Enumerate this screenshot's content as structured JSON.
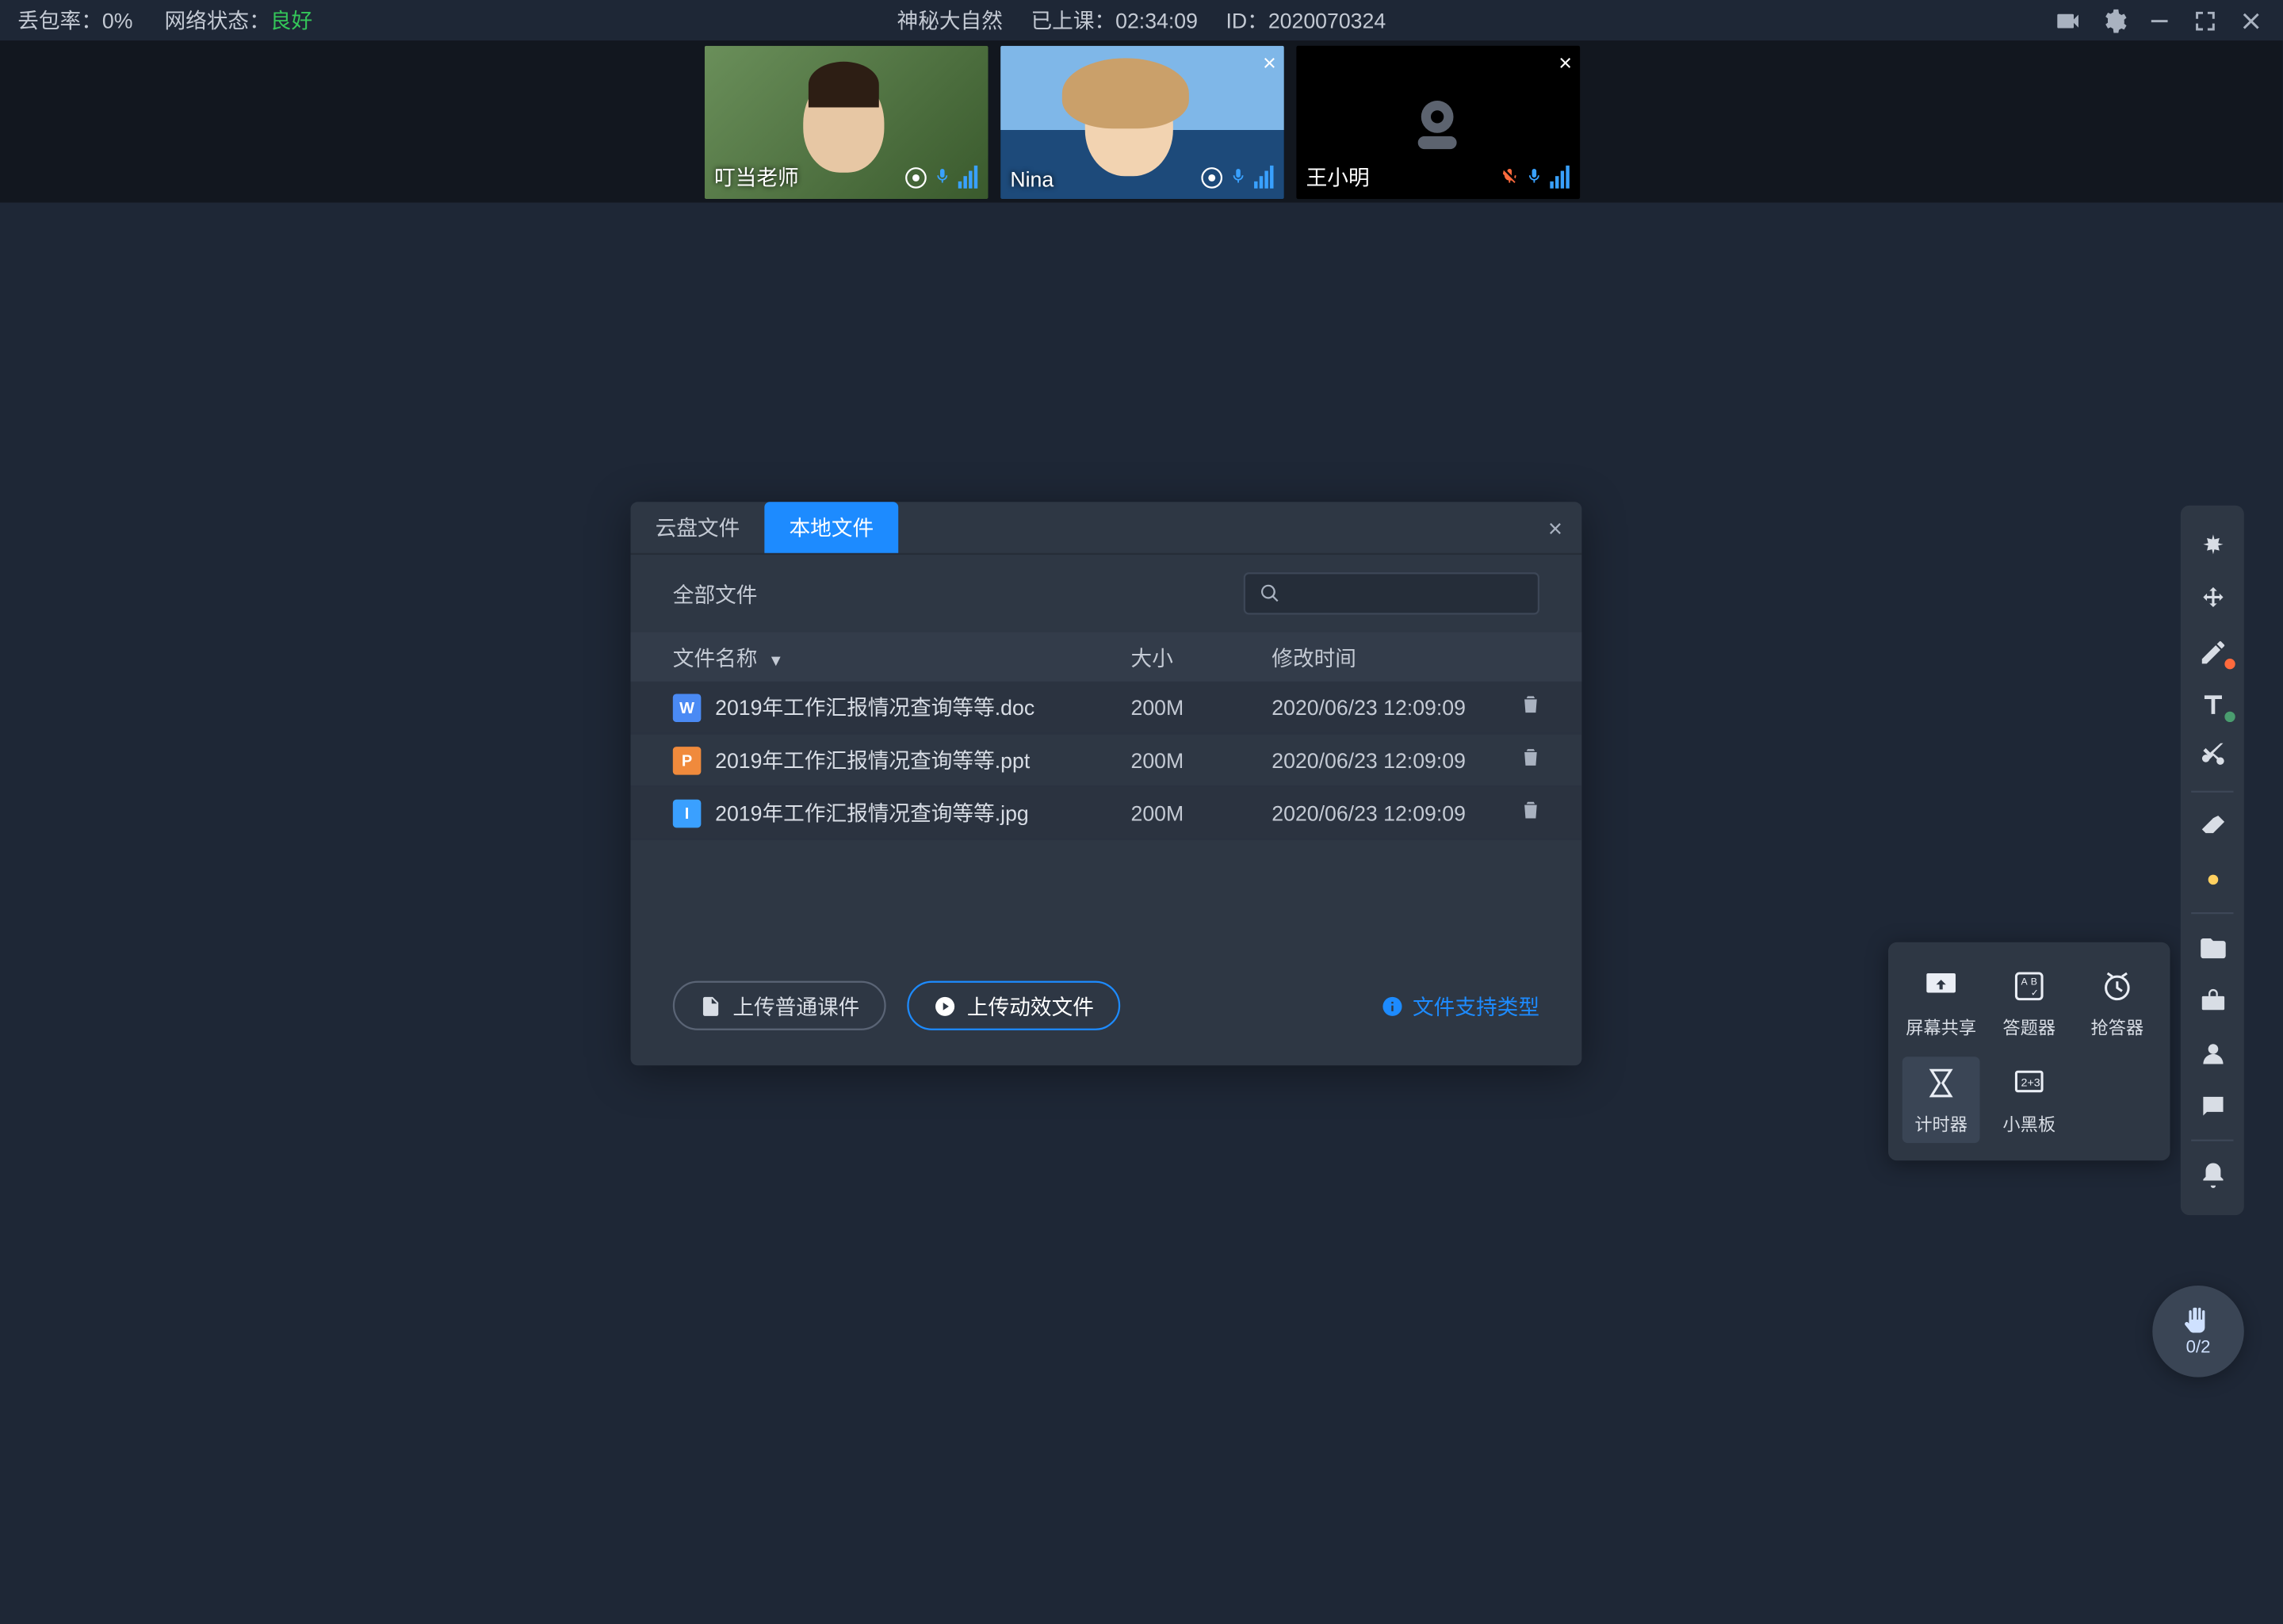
{
  "topbar": {
    "packet_loss_label": "丢包率：",
    "packet_loss_value": "0%",
    "net_label": "网络状态：",
    "net_value": "良好",
    "title": "神秘大自然",
    "elapsed_label": "已上课：",
    "elapsed_value": "02:34:09",
    "id_label": "ID：",
    "id_value": "2020070324"
  },
  "videos": [
    {
      "name": "叮当老师",
      "cam": "on",
      "mic": "on",
      "closable": false
    },
    {
      "name": "Nina",
      "cam": "on",
      "mic": "on",
      "closable": true
    },
    {
      "name": "王小明",
      "cam": "off",
      "mic": "off",
      "closable": true
    }
  ],
  "dialog": {
    "tabs": {
      "cloud": "云盘文件",
      "local": "本地文件"
    },
    "all_files": "全部文件",
    "columns": {
      "name": "文件名称",
      "size": "大小",
      "mtime": "修改时间"
    },
    "rows": [
      {
        "icon": "W",
        "name": "2019年工作汇报情况查询等等.doc",
        "size": "200M",
        "mtime": "2020/06/23 12:09:09"
      },
      {
        "icon": "P",
        "name": "2019年工作汇报情况查询等等.ppt",
        "size": "200M",
        "mtime": "2020/06/23 12:09:09"
      },
      {
        "icon": "I",
        "name": "2019年工作汇报情况查询等等.jpg",
        "size": "200M",
        "mtime": "2020/06/23 12:09:09"
      }
    ],
    "btn_upload_normal": "上传普通课件",
    "btn_upload_dynamic": "上传动效文件",
    "hint": "文件支持类型"
  },
  "popover": {
    "screen": "屏幕共享",
    "quiz": "答题器",
    "buzz": "抢答器",
    "timer": "计时器",
    "board": "小黑板"
  },
  "hand": {
    "count": "0/2"
  }
}
